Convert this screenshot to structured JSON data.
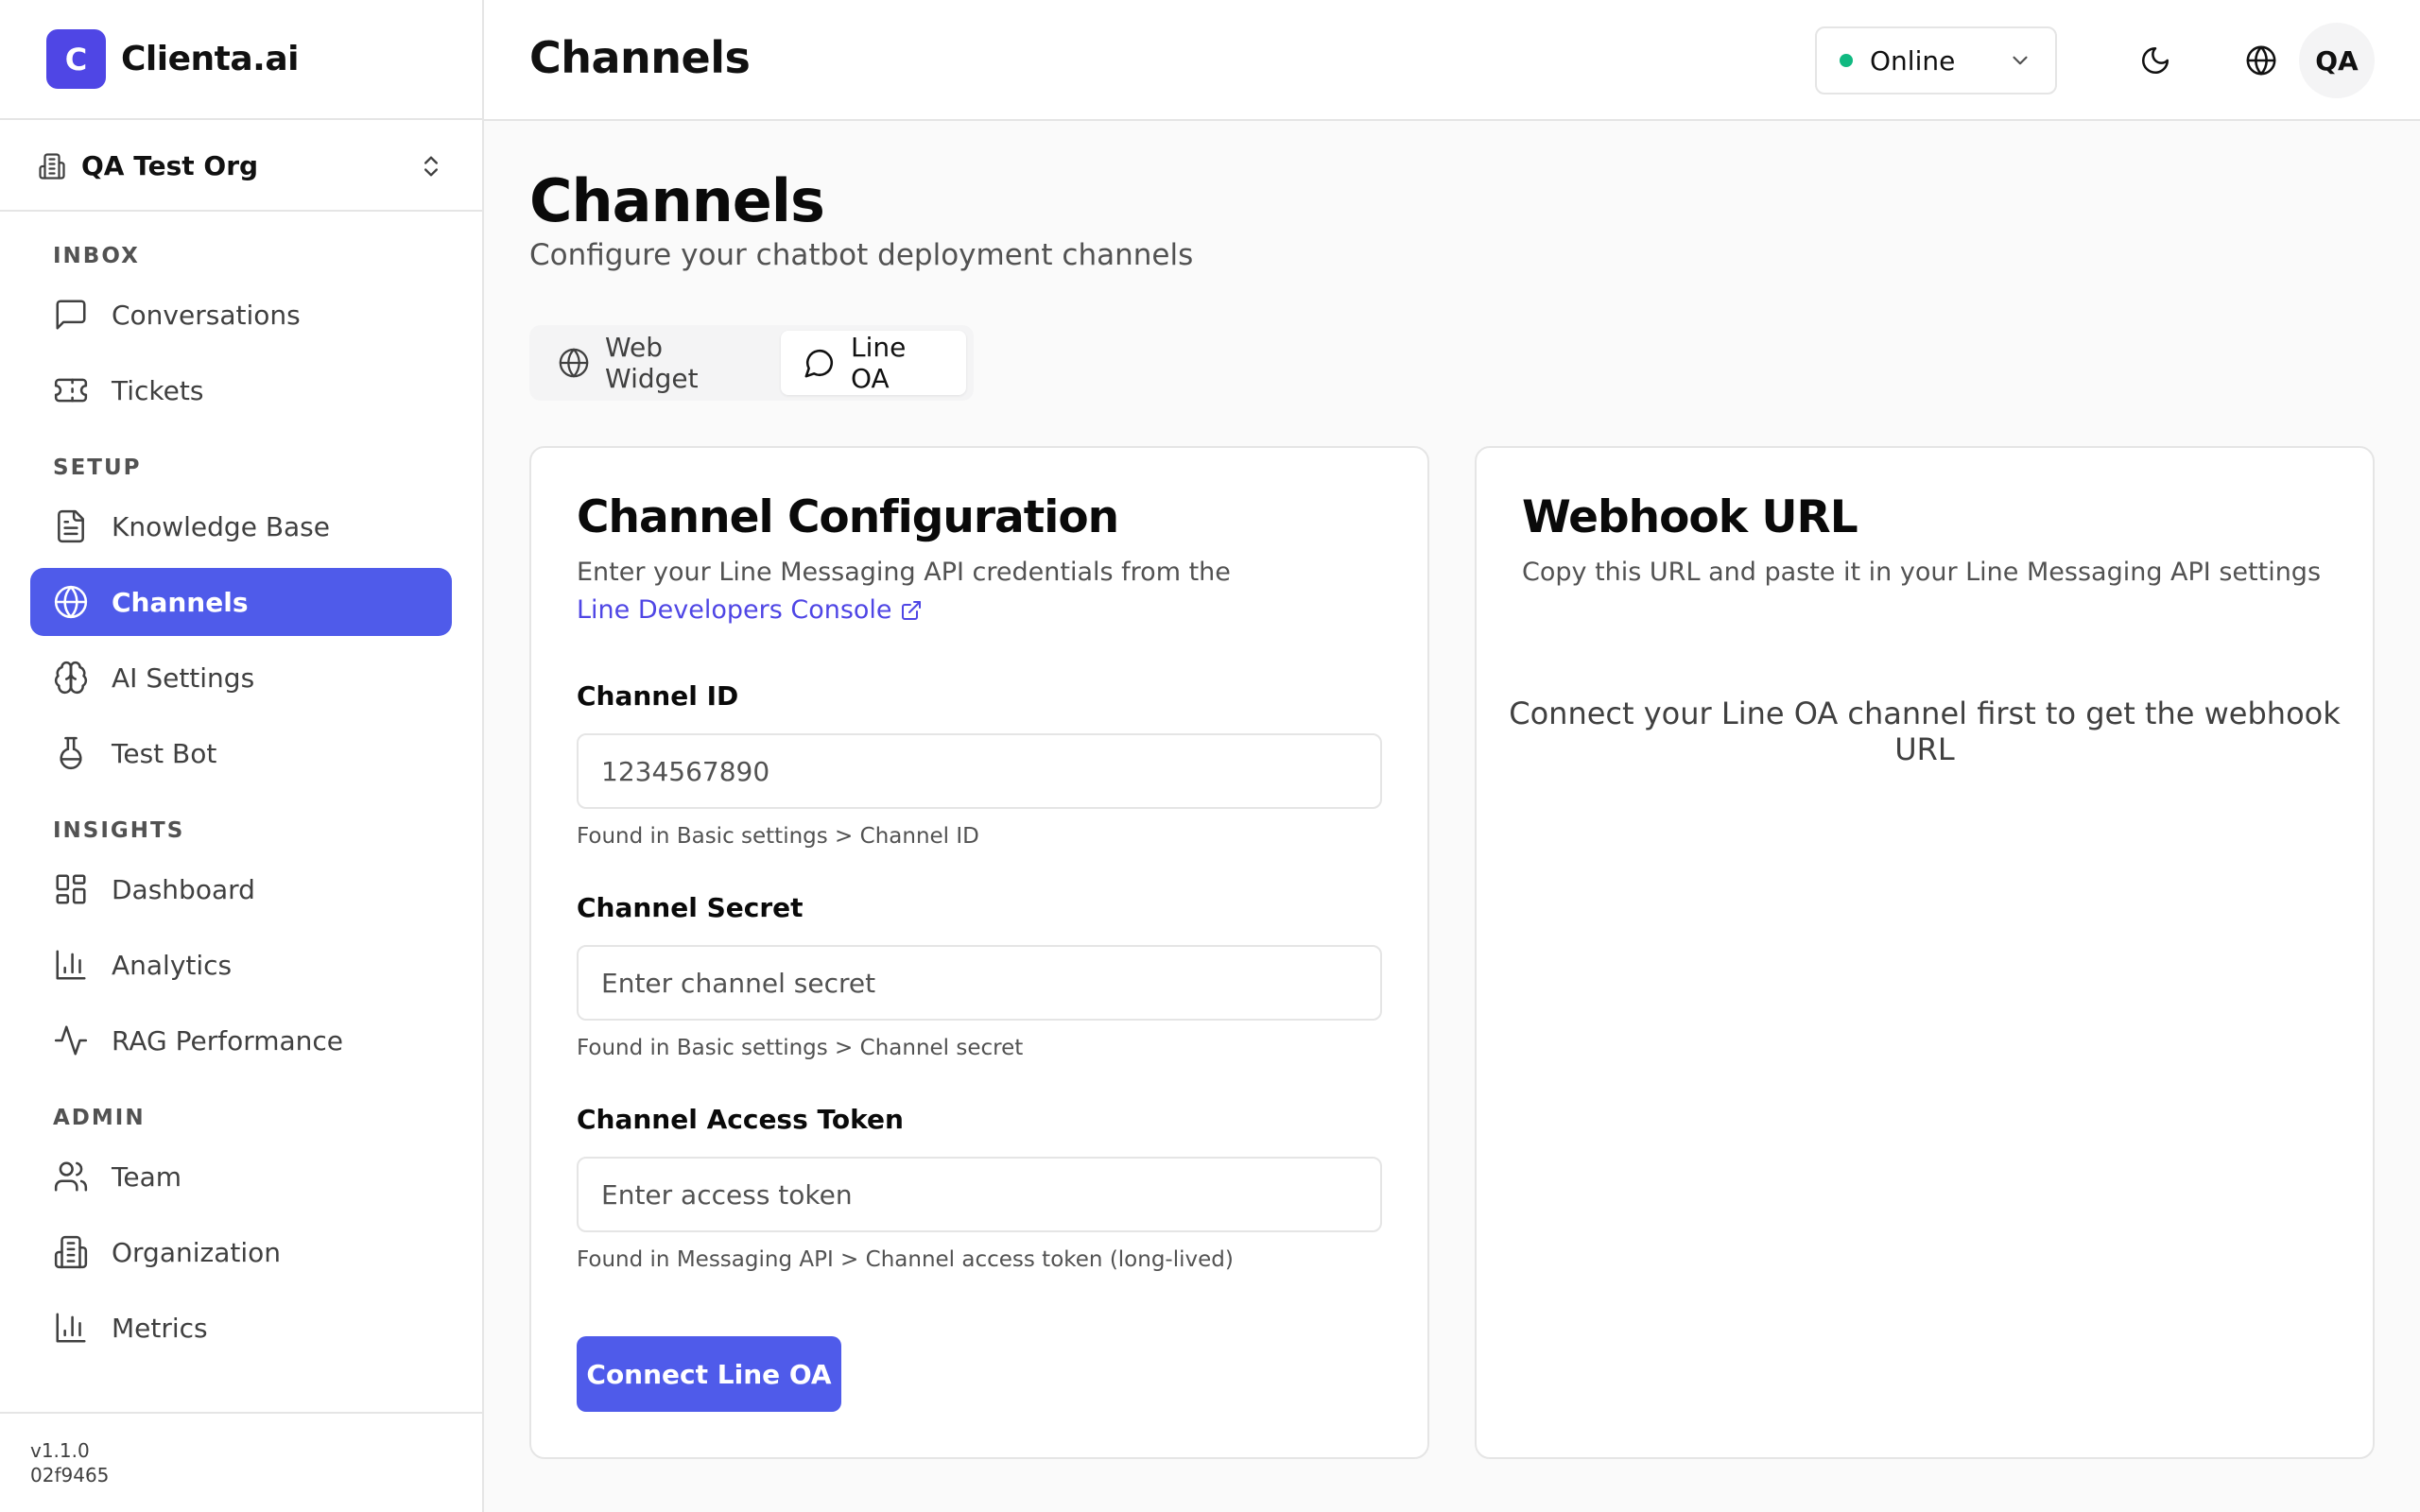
{
  "brand": {
    "logo_letter": "C",
    "name": "Clienta.ai",
    "accent": "#4f46e5"
  },
  "org_switcher": {
    "name": "QA Test Org"
  },
  "sidebar": {
    "sections": [
      {
        "title": "INBOX",
        "items": [
          {
            "label": "Conversations",
            "icon": "message-square-icon"
          },
          {
            "label": "Tickets",
            "icon": "ticket-icon"
          }
        ]
      },
      {
        "title": "SETUP",
        "items": [
          {
            "label": "Knowledge Base",
            "icon": "file-text-icon"
          },
          {
            "label": "Channels",
            "icon": "globe-icon",
            "active": true
          },
          {
            "label": "AI Settings",
            "icon": "brain-icon"
          },
          {
            "label": "Test Bot",
            "icon": "flask-icon"
          }
        ]
      },
      {
        "title": "INSIGHTS",
        "items": [
          {
            "label": "Dashboard",
            "icon": "layout-dashboard-icon"
          },
          {
            "label": "Analytics",
            "icon": "bar-chart-icon"
          },
          {
            "label": "RAG Performance",
            "icon": "activity-icon"
          }
        ]
      },
      {
        "title": "ADMIN",
        "items": [
          {
            "label": "Team",
            "icon": "users-icon"
          },
          {
            "label": "Organization",
            "icon": "building-icon"
          },
          {
            "label": "Metrics",
            "icon": "bar-chart-icon"
          }
        ]
      }
    ],
    "footer": {
      "version": "v1.1.0",
      "build": "02f9465"
    }
  },
  "header": {
    "title": "Channels",
    "status": {
      "label": "Online",
      "color": "#10b981"
    },
    "avatar_initials": "QA"
  },
  "main": {
    "title": "Channels",
    "subtitle": "Configure your chatbot deployment channels",
    "tabs": [
      {
        "label": "Web Widget",
        "icon": "globe-icon"
      },
      {
        "label": "Line OA",
        "icon": "message-circle-icon",
        "active": true
      }
    ]
  },
  "config_card": {
    "title": "Channel Configuration",
    "description": "Enter your Line Messaging API credentials from the",
    "link_label": "Line Developers Console",
    "fields": {
      "channel_id": {
        "label": "Channel ID",
        "placeholder": "1234567890",
        "hint": "Found in Basic settings > Channel ID"
      },
      "channel_secret": {
        "label": "Channel Secret",
        "placeholder": "Enter channel secret",
        "hint": "Found in Basic settings > Channel secret"
      },
      "access_token": {
        "label": "Channel Access Token",
        "placeholder": "Enter access token",
        "hint": "Found in Messaging API > Channel access token (long-lived)"
      }
    },
    "submit_label": "Connect Line OA"
  },
  "webhook_card": {
    "title": "Webhook URL",
    "description": "Copy this URL and paste it in your Line Messaging API settings",
    "empty_message": "Connect your Line OA channel first to get the webhook URL"
  }
}
